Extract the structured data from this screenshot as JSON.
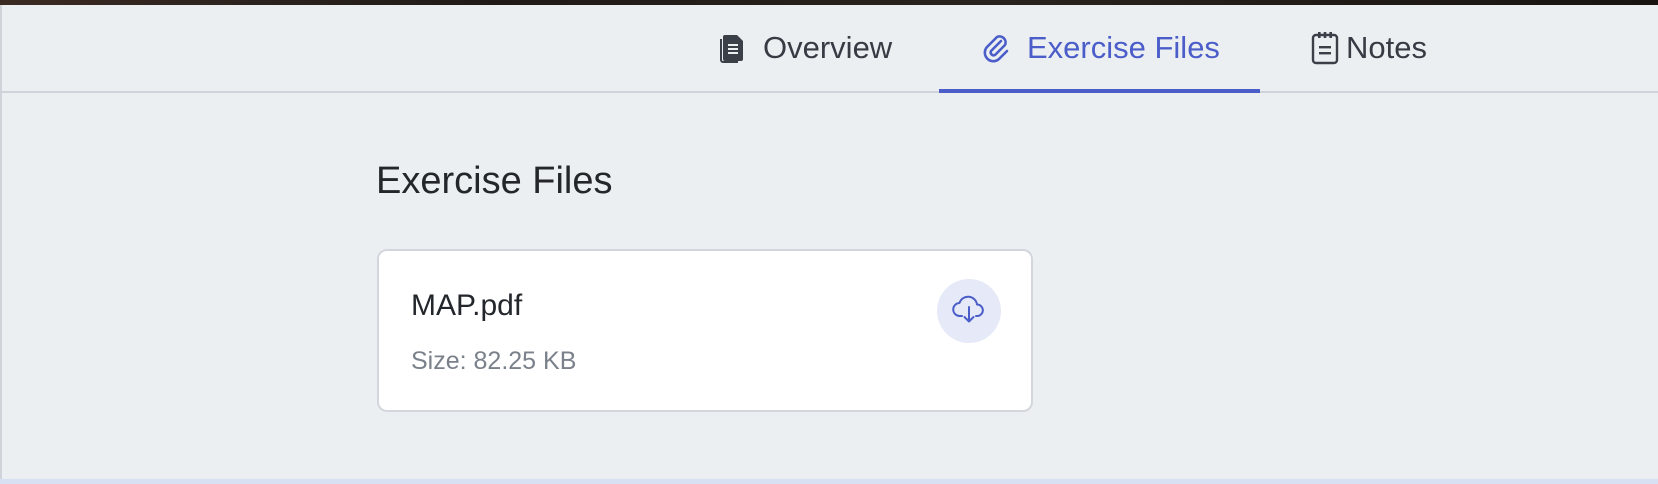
{
  "tabs": [
    {
      "label": "Overview",
      "icon": "document-icon",
      "active": false
    },
    {
      "label": "Exercise Files",
      "icon": "paperclip-icon",
      "active": true
    },
    {
      "label": "Notes",
      "icon": "notepad-icon",
      "active": false
    }
  ],
  "main": {
    "title": "Exercise Files",
    "files": [
      {
        "name": "MAP.pdf",
        "size": "Size: 82.25 KB",
        "action_icon": "cloud-download-icon"
      }
    ]
  },
  "colors": {
    "accent": "#4a5dc9",
    "background": "#eceff2",
    "card": "#ffffff",
    "download_bg": "#e6eaf8"
  }
}
